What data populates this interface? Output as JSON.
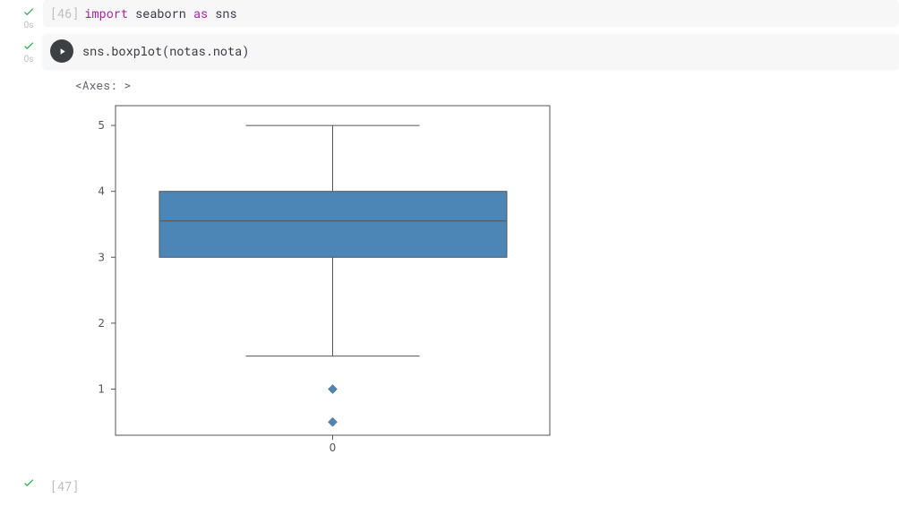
{
  "cells": [
    {
      "status": "ok",
      "time": "0s",
      "exec_count": "[46]",
      "code_tokens": {
        "import_kw": "import",
        "module": "seaborn",
        "as_kw": "as",
        "alias": "sns"
      }
    },
    {
      "status": "ok",
      "time": "0s",
      "run_button": true,
      "code": "sns.boxplot(notas.nota)",
      "output_repr": "<Axes: >"
    },
    {
      "status": "ok",
      "exec_count": "[47]"
    }
  ],
  "colors": {
    "check": "#34a853",
    "run_bg": "#3c4043",
    "box_fill": "#4c86b6"
  },
  "chart_data": {
    "type": "boxplot",
    "categories": [
      "0"
    ],
    "q1": 3.0,
    "median": 3.55,
    "q3": 4.0,
    "whisker_low": 1.5,
    "whisker_high": 5.0,
    "outliers": [
      1.0,
      0.5
    ],
    "ylim": [
      0.3,
      5.3
    ],
    "yticks": [
      1,
      2,
      3,
      4,
      5
    ],
    "xlabel": "0",
    "xtick": "0"
  }
}
